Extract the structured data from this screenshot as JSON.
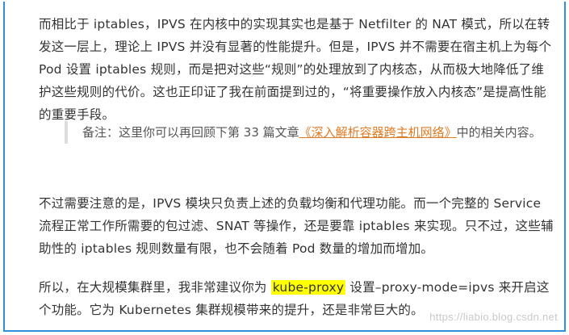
{
  "article": {
    "paragraph1": "而相比于 iptables，IPVS 在内核中的实现其实也是基于 Netfilter 的 NAT 模式，所以在转发这一层上，理论上 IPVS 并没有显著的性能提升。但是，IPVS 并不需要在宿主机上为每个 Pod 设置 iptables 规则，而是把对这些“规则”的处理放到了内核态，从而极大地降低了维护这些规则的代价。这也正印证了我在前面提到过的，“将重要操作放入内核态”是提高性能的重要手段。",
    "note": {
      "prefix": "备注：这里你可以再回顾下第 33 篇文章",
      "link": "《深入解析容器跨主机网络》",
      "suffix": "中的相关内容。"
    },
    "paragraph2": "不过需要注意的是，IPVS 模块只负责上述的负载均衡和代理功能。而一个完整的 Service 流程正常工作所需要的包过滤、SNAT 等操作，还是要靠 iptables 来实现。只不过，这些辅助性的 iptables 规则数量有限，也不会随着 Pod 数量的增加而增加。",
    "paragraph3": {
      "prefix": "所以，在大规模集群里，我非常建议你为 ",
      "highlight": "kube-proxy",
      "suffix": " 设置–proxy-mode=ipvs 来开启这个功能。它为 Kubernetes 集群规模带来的提升，还是非常巨大的。"
    }
  },
  "watermark": "https://liabio.blog.csdn.net",
  "colors": {
    "border": "#2f8fe0",
    "link": "#e07b24",
    "highlight": "#ffff00",
    "text": "#333333"
  }
}
